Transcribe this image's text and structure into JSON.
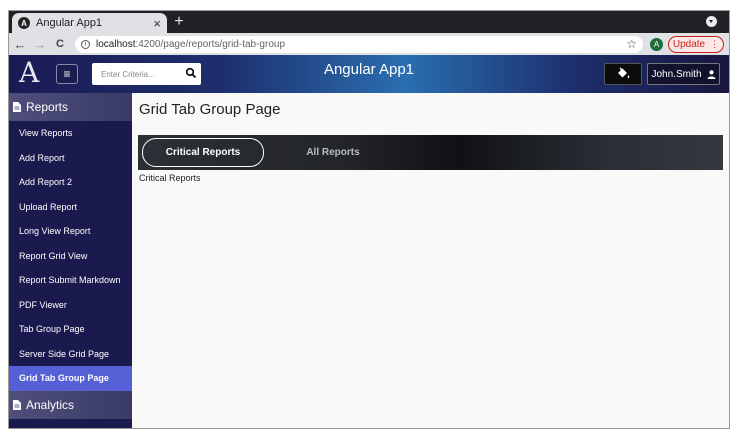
{
  "browser": {
    "tab_title": "Angular App1",
    "tab_close": "×",
    "new_tab": "+",
    "nav_back": "←",
    "nav_forward": "→",
    "nav_reload": "C",
    "url_host": "localhost",
    "url_path": ":4200/page/reports/grid-tab-group",
    "star": "☆",
    "avatar_letter": "A",
    "update_label": "Update",
    "update_dots": "⋮"
  },
  "header": {
    "logo_text": "A",
    "menu_glyph": "≡",
    "search_placeholder": "Enter Criteria...",
    "app_title": "Angular App1",
    "user_name": "John.Smith"
  },
  "sidebar": {
    "section_reports": "Reports",
    "items": [
      {
        "label": "View Reports"
      },
      {
        "label": "Add Report"
      },
      {
        "label": "Add Report 2"
      },
      {
        "label": "Upload Report"
      },
      {
        "label": "Long View Report"
      },
      {
        "label": "Report Grid View"
      },
      {
        "label": "Report Submit Markdown"
      },
      {
        "label": "PDF Viewer"
      },
      {
        "label": "Tab Group Page"
      },
      {
        "label": "Server Side Grid Page"
      },
      {
        "label": "Grid Tab Group Page"
      }
    ],
    "section_analytics": "Analytics"
  },
  "main": {
    "page_title": "Grid Tab Group Page",
    "tabs": [
      {
        "label": "Critical Reports"
      },
      {
        "label": "All Reports"
      }
    ],
    "content_text": "Critical Reports"
  },
  "colors": {
    "sidebar_bg": "#1a1a4f",
    "active_item": "#5560d6",
    "update_red": "#c5221f"
  }
}
